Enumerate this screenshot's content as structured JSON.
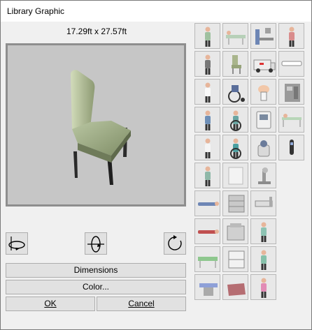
{
  "window": {
    "title": "Library Graphic"
  },
  "preview": {
    "dimensions": "17.29ft x 27.57ft"
  },
  "rotation": {
    "buttons": [
      "rotate-horizontal",
      "rotate-vertical",
      "rotate-flat"
    ]
  },
  "buttons": {
    "dimensions": "Dimensions",
    "color": "Color...",
    "ok": "OK",
    "cancel": "Cancel"
  },
  "gallery": {
    "items": [
      [
        "person-sitting",
        "patient-stretcher",
        "x-ray-machine",
        "person-kneeling"
      ],
      [
        "person-standing",
        "chair",
        "ambulance",
        "wall-mount-rail"
      ],
      [
        "doctor-standing",
        "wheelchair",
        "toilet",
        "cabinet-machine"
      ],
      [
        "person-walking",
        "person-wheelchair",
        "monitor-cart",
        "gurney"
      ],
      [
        "nurse-standing",
        "patient-wheelchair",
        "lab-device",
        "iv-pole"
      ],
      [
        "nurse-scrubs",
        "patient-chair",
        "microscope",
        ""
      ],
      [
        "person-lying",
        "supply-cart",
        "hospital-bed",
        ""
      ],
      [
        "patient-lying",
        "copier-machine",
        "surgeon-standing",
        ""
      ],
      [
        "stretcher-bed",
        "linen-cart",
        "person-standing-green",
        ""
      ],
      [
        "exam-table",
        "folded-blanket",
        "person-pink",
        ""
      ]
    ]
  }
}
